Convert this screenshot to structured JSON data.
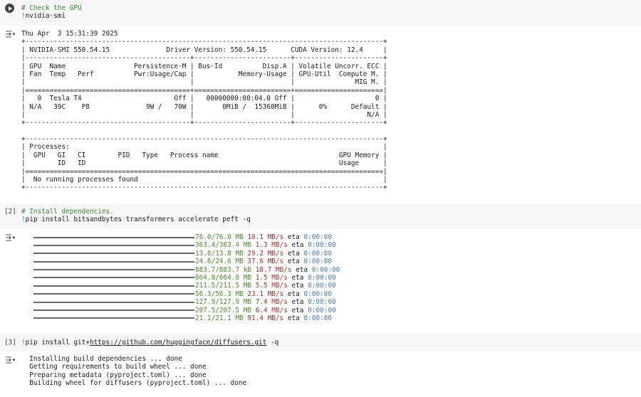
{
  "cells": [
    {
      "label": "",
      "comment": "# Check the GPU",
      "bang": "!",
      "command": "nvidia-smi"
    },
    {
      "label": "[2]",
      "comment": "# Install dependencies.",
      "bang": "!",
      "command": "pip install bitsandbytes transformers accelerate peft -q"
    },
    {
      "label": "[3]",
      "bang": "!",
      "command_pre": "pip install git+",
      "command_link": "https://github.com/huggingface/diffusers.git",
      "command_post": " -q"
    }
  ],
  "nvidia_output": [
    "Thu Apr  3 15:31:39 2025       ",
    "+-----------------------------------------------------------------------------------------+",
    "| NVIDIA-SMI 550.54.15              Driver Version: 550.54.15      CUDA Version: 12.4     |",
    "|-----------------------------------------+------------------------+----------------------+",
    "| GPU  Name                 Persistence-M | Bus-Id          Disp.A | Volatile Uncorr. ECC |",
    "| Fan  Temp   Perf          Pwr:Usage/Cap |           Memory-Usage | GPU-Util  Compute M. |",
    "|                                         |                        |               MIG M. |",
    "|=========================================+========================+======================|",
    "|   0  Tesla T4                       Off |   00000000:00:04.0 Off |                    0 |",
    "| N/A   39C    P8              9W /   70W |       0MiB /  15360MiB |      0%      Default |",
    "|                                         |                        |                  N/A |",
    "+-----------------------------------------+------------------------+----------------------+",
    " ",
    "+-----------------------------------------------------------------------------------------+",
    "| Processes:                                                                              |",
    "|  GPU   GI   CI        PID   Type   Process name                              GPU Memory |",
    "|        ID   ID                                                               Usage      |",
    "|=========================================================================================|",
    "|  No running processes found                                                             |",
    "+-----------------------------------------------------------------------------------------+"
  ],
  "pip_progress": [
    {
      "size": "76.0/76.0 MB",
      "speed": "10.1 MB/s",
      "eta_label": "eta",
      "eta": "0:00:00",
      "progress": 1.0
    },
    {
      "size": "363.4/363.4 MB",
      "speed": "1.3 MB/s",
      "eta_label": "eta",
      "eta": "0:00:00",
      "progress": 1.0
    },
    {
      "size": "13.8/13.8 MB",
      "speed": "29.2 MB/s",
      "eta_label": "eta",
      "eta": "0:00:00",
      "progress": 1.0
    },
    {
      "size": "24.6/24.6 MB",
      "speed": "37.6 MB/s",
      "eta_label": "eta",
      "eta": "0:00:00",
      "progress": 1.0
    },
    {
      "size": "883.7/883.7 kB",
      "speed": "18.7 MB/s",
      "eta_label": "eta",
      "eta": "0:00:00",
      "progress": 1.0
    },
    {
      "size": "664.8/664.8 MB",
      "speed": "1.5 MB/s",
      "eta_label": "eta",
      "eta": "0:00:00",
      "progress": 1.0
    },
    {
      "size": "211.5/211.5 MB",
      "speed": "5.5 MB/s",
      "eta_label": "eta",
      "eta": "0:00:00",
      "progress": 1.0
    },
    {
      "size": "56.3/56.3 MB",
      "speed": "23.1 MB/s",
      "eta_label": "eta",
      "eta": "0:00:00",
      "progress": 1.0
    },
    {
      "size": "127.9/127.9 MB",
      "speed": "7.4 MB/s",
      "eta_label": "eta",
      "eta": "0:00:00",
      "progress": 1.0
    },
    {
      "size": "207.5/207.5 MB",
      "speed": "6.4 MB/s",
      "eta_label": "eta",
      "eta": "0:00:00",
      "progress": 1.0
    },
    {
      "size": "21.1/21.1 MB",
      "speed": "91.4 MB/s",
      "eta_label": "eta",
      "eta": "0:00:00",
      "progress": 1.0
    }
  ],
  "diffusers_output": [
    "  Installing build dependencies ... done",
    "  Getting requirements to build wheel ... done",
    "  Preparing metadata (pyproject.toml) ... done",
    "  Building wheel for diffusers (pyproject.toml) ... done"
  ],
  "colors": {
    "size": "#4e8f2a",
    "speed": "#a8322c",
    "eta": "#4a7fbf",
    "comment": "#3a8a35",
    "cell_bg": "#f7f7f7"
  }
}
